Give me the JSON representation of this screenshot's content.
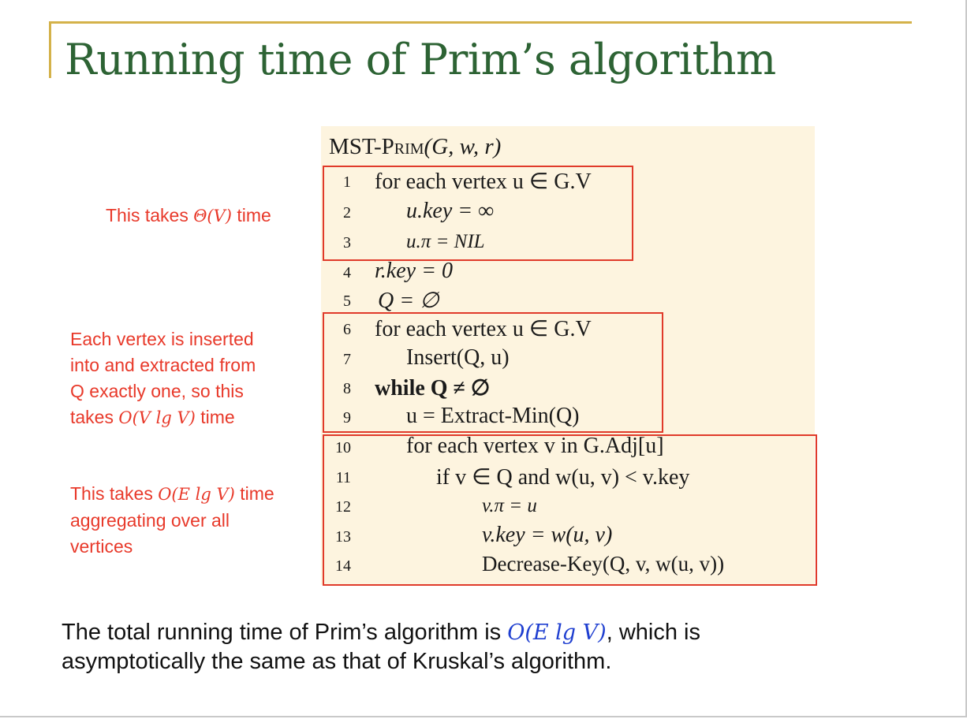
{
  "slide": {
    "title": "Running time of Prim’s algorithm"
  },
  "code": {
    "header_prefix": "MST-",
    "header_name": "Prim",
    "header_args": "(G, w, r)",
    "lines": [
      {
        "n": "1",
        "text": "for each vertex u ∈ G.V"
      },
      {
        "n": "2",
        "text": "u.key = ∞"
      },
      {
        "n": "3",
        "text": "u.π = NIL"
      },
      {
        "n": "4",
        "text": "r.key = 0"
      },
      {
        "n": "5",
        "text": "Q = ∅"
      },
      {
        "n": "6",
        "text": "for each vertex u ∈ G.V"
      },
      {
        "n": "7",
        "text": "Insert(Q, u)"
      },
      {
        "n": "8",
        "text": "while Q ≠ ∅"
      },
      {
        "n": "9",
        "text": "u = Extract-Min(Q)"
      },
      {
        "n": "10",
        "text": "for each vertex v in G.Adj[u]"
      },
      {
        "n": "11",
        "text": "if v ∈ Q and w(u, v) < v.key"
      },
      {
        "n": "12",
        "text": "v.π = u"
      },
      {
        "n": "13",
        "text": "v.key = w(u, v)"
      },
      {
        "n": "14",
        "text": "Decrease-Key(Q, v, w(u, v))"
      }
    ]
  },
  "notes": {
    "note1": {
      "pre": "This takes ",
      "math": "Θ(V)",
      "post": " time"
    },
    "note2": {
      "line1": "Each vertex is inserted",
      "line2": "into and extracted from",
      "line3": "Q exactly one, so this",
      "line4_pre": "takes ",
      "line4_math": "O(V lg V)",
      "line4_post": " time"
    },
    "note3": {
      "line1_pre": "This takes ",
      "line1_math": "O(E lg V)",
      "line1_post": " time",
      "line2": "aggregating over all",
      "line3": "vertices"
    }
  },
  "footer": {
    "pre": "The total running time of Prim’s algorithm is ",
    "math": "O(E lg V)",
    "post": ", which is",
    "line2": "asymptotically the same as that of Kruskal’s algorithm."
  },
  "colors": {
    "title": "#2d6334",
    "accent_rule": "#d4b24a",
    "code_bg": "#fdf4df",
    "highlight": "#e03a2a",
    "note_text": "#e8392a",
    "footer_math": "#1f3fd0"
  }
}
